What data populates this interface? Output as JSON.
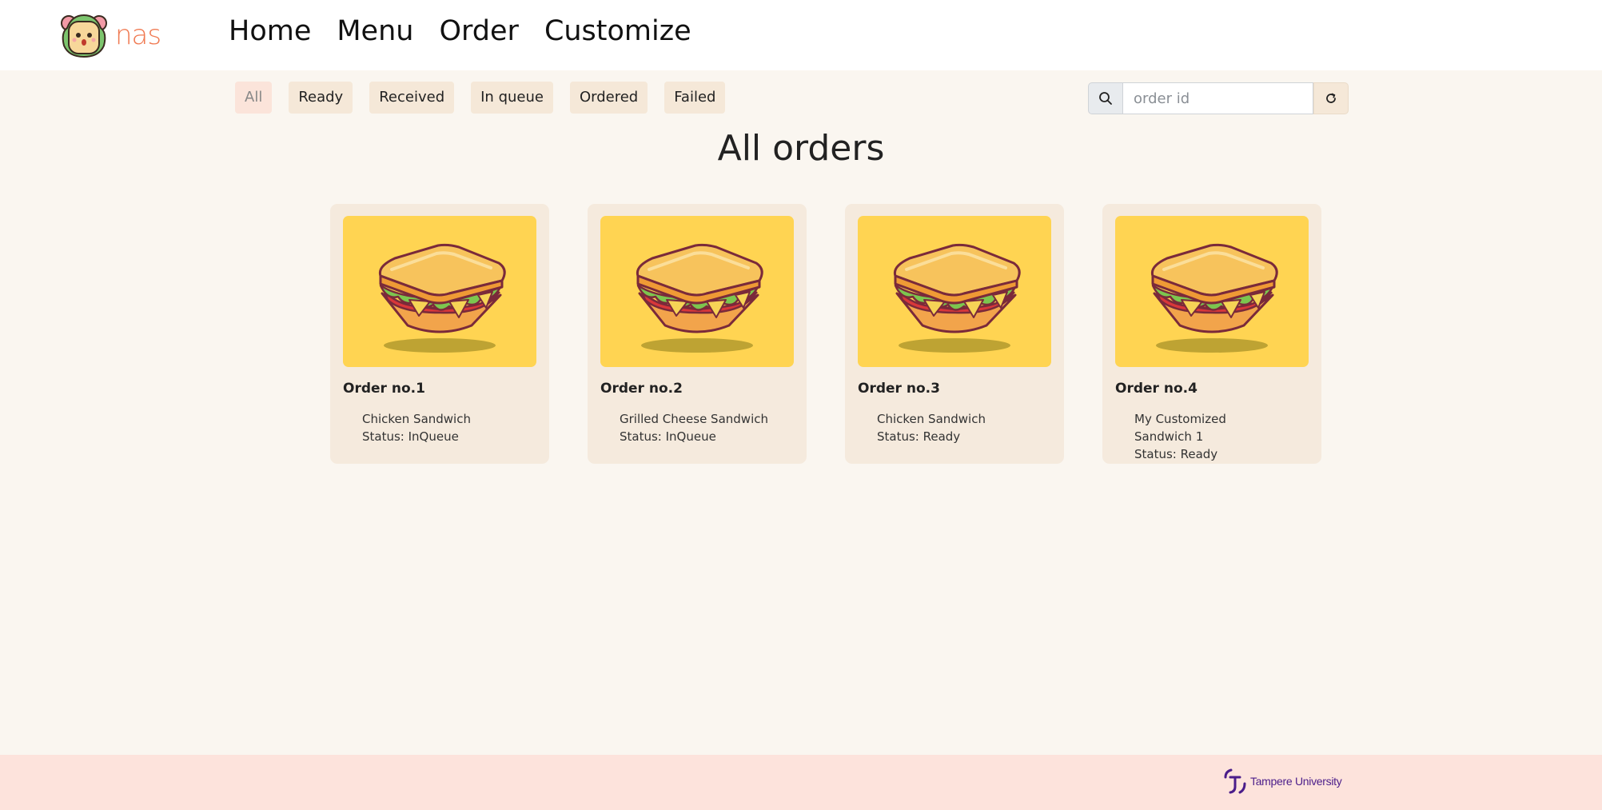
{
  "brand": {
    "name": "nas"
  },
  "nav": [
    {
      "label": "Home"
    },
    {
      "label": "Menu"
    },
    {
      "label": "Order"
    },
    {
      "label": "Customize"
    }
  ],
  "filters": [
    {
      "label": "All",
      "active": true
    },
    {
      "label": "Ready"
    },
    {
      "label": "Received"
    },
    {
      "label": "In queue"
    },
    {
      "label": "Ordered"
    },
    {
      "label": "Failed"
    }
  ],
  "search": {
    "placeholder": "order id",
    "value": "",
    "icon": "search-icon",
    "refresh_icon": "refresh-icon"
  },
  "page_title": "All orders",
  "orders": [
    {
      "title": "Order no.1",
      "item": "Chicken Sandwich",
      "status": "Status: InQueue"
    },
    {
      "title": "Order no.2",
      "item": "Grilled Cheese Sandwich",
      "status": "Status: InQueue"
    },
    {
      "title": "Order no.3",
      "item": "Chicken Sandwich",
      "status": "Status: Ready"
    },
    {
      "title": "Order no.4",
      "item": "My Customized Sandwich 1",
      "status": "Status: Ready"
    }
  ],
  "footer": {
    "university": "Tampere University"
  },
  "colors": {
    "accent": "#f07a52",
    "card_image_bg": "#ffd452",
    "footer_bg": "#fde3dc",
    "page_bg": "#faf6f0"
  }
}
